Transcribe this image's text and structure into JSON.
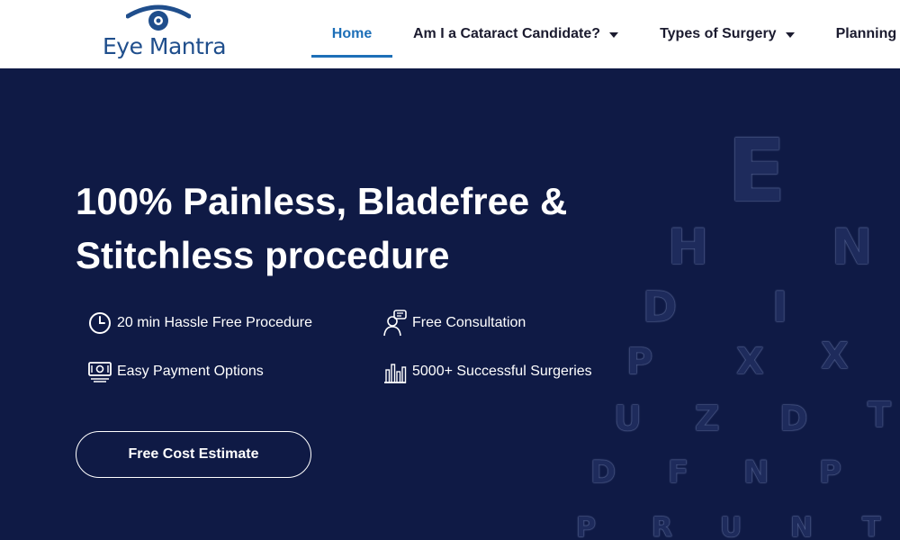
{
  "brand": {
    "name": "Eye Mantra",
    "color": "#1f4e8c"
  },
  "nav": {
    "items": [
      {
        "label": "Home",
        "active": true,
        "dropdown": false
      },
      {
        "label": "Am I a Cataract Candidate?",
        "active": false,
        "dropdown": true
      },
      {
        "label": "Types of Surgery",
        "active": false,
        "dropdown": true
      },
      {
        "label": "Planning",
        "active": false,
        "dropdown": false
      }
    ],
    "active_color": "#1d6fb8"
  },
  "hero": {
    "headline": "100% Painless, Bladefree & Stitchless procedure",
    "background_color": "#0f1a45",
    "features": [
      {
        "icon": "clock-icon",
        "label": "20 min Hassle Free Procedure"
      },
      {
        "icon": "consultation-icon",
        "label": "Free Consultation"
      },
      {
        "icon": "payment-icon",
        "label": "Easy Payment Options"
      },
      {
        "icon": "surgeries-chart-icon",
        "label": "5000+ Successful Surgeries"
      }
    ],
    "cta_label": "Free Cost Estimate",
    "eye_chart_letters": [
      "E",
      "H",
      "N",
      "D",
      "I",
      "X",
      "P",
      "T",
      "X",
      "U",
      "Z",
      "D",
      "T",
      "D",
      "F",
      "N",
      "P",
      "P",
      "R",
      "U",
      "N",
      "T"
    ]
  }
}
